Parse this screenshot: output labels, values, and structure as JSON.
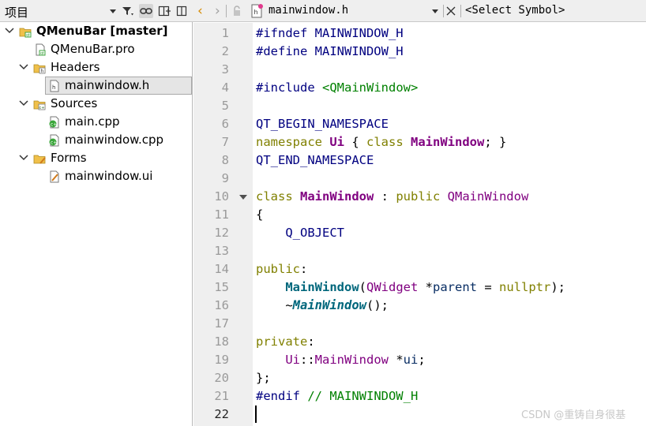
{
  "project_panel": {
    "title": "项目",
    "tree": [
      {
        "label": "QMenuBar [master]",
        "bold": true,
        "icon": "project-icon",
        "expanded": true
      },
      {
        "label": "QMenuBar.pro",
        "icon": "pro-file-icon"
      },
      {
        "label": "Headers",
        "icon": "headers-folder-icon",
        "expanded": true
      },
      {
        "label": "mainwindow.h",
        "icon": "header-file-icon",
        "selected": true
      },
      {
        "label": "Sources",
        "icon": "sources-folder-icon",
        "expanded": true
      },
      {
        "label": "main.cpp",
        "icon": "cpp-file-icon"
      },
      {
        "label": "mainwindow.cpp",
        "icon": "cpp-file-icon"
      },
      {
        "label": "Forms",
        "icon": "forms-folder-icon",
        "expanded": true
      },
      {
        "label": "mainwindow.ui",
        "icon": "ui-file-icon"
      }
    ]
  },
  "editor": {
    "file_name": "mainwindow.h",
    "symbol_placeholder": "<Select Symbol>",
    "current_line": "22",
    "lines": [
      {
        "no": "1",
        "tokens": [
          [
            "pre",
            "#ifndef MAINWINDOW_H"
          ]
        ]
      },
      {
        "no": "2",
        "tokens": [
          [
            "pre",
            "#define MAINWINDOW_H"
          ]
        ]
      },
      {
        "no": "3",
        "tokens": []
      },
      {
        "no": "4",
        "tokens": [
          [
            "pre",
            "#include "
          ],
          [
            "str",
            "<QMainWindow>"
          ]
        ]
      },
      {
        "no": "5",
        "tokens": []
      },
      {
        "no": "6",
        "tokens": [
          [
            "mac",
            "QT_BEGIN_NAMESPACE"
          ]
        ]
      },
      {
        "no": "7",
        "tokens": [
          [
            "kw",
            "namespace "
          ],
          [
            "type",
            "Ui"
          ],
          [
            "plain",
            " { "
          ],
          [
            "kw",
            "class "
          ],
          [
            "type",
            "MainWindow"
          ],
          [
            "plain",
            "; }"
          ]
        ]
      },
      {
        "no": "8",
        "tokens": [
          [
            "mac",
            "QT_END_NAMESPACE"
          ]
        ]
      },
      {
        "no": "9",
        "tokens": []
      },
      {
        "no": "10",
        "fold": true,
        "tokens": [
          [
            "kw",
            "class "
          ],
          [
            "type",
            "MainWindow"
          ],
          [
            "plain",
            " : "
          ],
          [
            "kw",
            "public "
          ],
          [
            "cls",
            "QMainWindow"
          ]
        ]
      },
      {
        "no": "11",
        "tokens": [
          [
            "plain",
            "{"
          ]
        ]
      },
      {
        "no": "12",
        "tokens": [
          [
            "plain",
            "    "
          ],
          [
            "mac",
            "Q_OBJECT"
          ]
        ]
      },
      {
        "no": "13",
        "tokens": []
      },
      {
        "no": "14",
        "tokens": [
          [
            "kw",
            "public"
          ],
          [
            "plain",
            ":"
          ]
        ]
      },
      {
        "no": "15",
        "tokens": [
          [
            "plain",
            "    "
          ],
          [
            "fn",
            "MainWindow"
          ],
          [
            "plain",
            "("
          ],
          [
            "cls",
            "QWidget"
          ],
          [
            "plain",
            " *"
          ],
          [
            "par",
            "parent"
          ],
          [
            "plain",
            " = "
          ],
          [
            "kw",
            "nullptr"
          ],
          [
            "plain",
            ");"
          ]
        ]
      },
      {
        "no": "16",
        "tokens": [
          [
            "plain",
            "    ~"
          ],
          [
            "fni",
            "MainWindow"
          ],
          [
            "plain",
            "();"
          ]
        ]
      },
      {
        "no": "17",
        "tokens": []
      },
      {
        "no": "18",
        "tokens": [
          [
            "kw",
            "private"
          ],
          [
            "plain",
            ":"
          ]
        ]
      },
      {
        "no": "19",
        "tokens": [
          [
            "plain",
            "    "
          ],
          [
            "cls",
            "Ui"
          ],
          [
            "plain",
            "::"
          ],
          [
            "cls",
            "MainWindow"
          ],
          [
            "plain",
            " *"
          ],
          [
            "par",
            "ui"
          ],
          [
            "plain",
            ";"
          ]
        ]
      },
      {
        "no": "20",
        "tokens": [
          [
            "plain",
            "};"
          ]
        ]
      },
      {
        "no": "21",
        "tokens": [
          [
            "pre",
            "#endif "
          ],
          [
            "cmt",
            "// MAINWINDOW_H"
          ]
        ]
      },
      {
        "no": "22",
        "tokens": []
      }
    ]
  },
  "watermark": "CSDN @重铸自身很基",
  "colors": {
    "preprocessor": "#000080",
    "string": "#008000",
    "keyword": "#808000",
    "type": "#800080",
    "function": "#00677c",
    "comment": "#008000",
    "gutter_bg": "#efefef",
    "selection_bg": "#e5e5e5"
  }
}
